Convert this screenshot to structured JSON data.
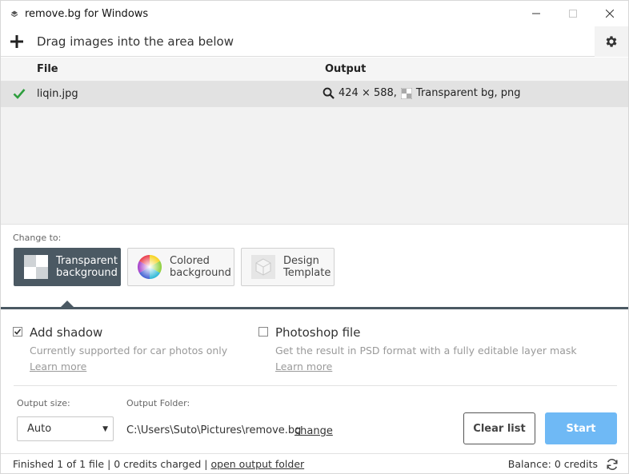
{
  "window": {
    "title": "remove.bg for Windows",
    "minimize_icon": "minimize-icon",
    "maximize_icon": "maximize-icon",
    "close_icon": "close-icon"
  },
  "toolbar": {
    "add_icon": "plus-icon",
    "drag_hint": "Drag images into the area below",
    "settings_icon": "gear-icon"
  },
  "file_list": {
    "columns": {
      "file": "File",
      "output": "Output"
    },
    "rows": [
      {
        "status": "done",
        "status_icon": "checkmark-icon",
        "file": "liqin.jpg",
        "output": "424 × 588,",
        "output_format": "Transparent bg, png"
      }
    ]
  },
  "change_to": {
    "label": "Change to:",
    "options": [
      {
        "line1": "Transparent",
        "line2": "background",
        "active": true
      },
      {
        "line1": "Colored",
        "line2": "background",
        "active": false
      },
      {
        "line1": "Design",
        "line2": "Template",
        "active": false
      }
    ]
  },
  "options": {
    "shadow": {
      "title": "Add shadow",
      "checked": true,
      "description": "Currently supported for car photos only",
      "link": "Learn more"
    },
    "photoshop": {
      "title": "Photoshop file",
      "checked": false,
      "description": "Get the result in PSD format with a fully editable layer mask",
      "link": "Learn more"
    }
  },
  "output": {
    "size_label": "Output size:",
    "size_value": "Auto",
    "folder_label": "Output Folder:",
    "folder_path": "C:\\Users\\Suto\\Pictures\\remove.bg",
    "folder_change": "change"
  },
  "buttons": {
    "clear": "Clear list",
    "start": "Start"
  },
  "status": {
    "summary": "Finished 1 of 1 file | 0 credits charged | ",
    "open_folder": "open output folder",
    "balance": "Balance: 0 credits",
    "refresh_icon": "refresh-icon"
  },
  "colors": {
    "accent_dark": "#4b5963",
    "start_blue": "#6fb9f5",
    "check_green": "#2e9e3e"
  }
}
